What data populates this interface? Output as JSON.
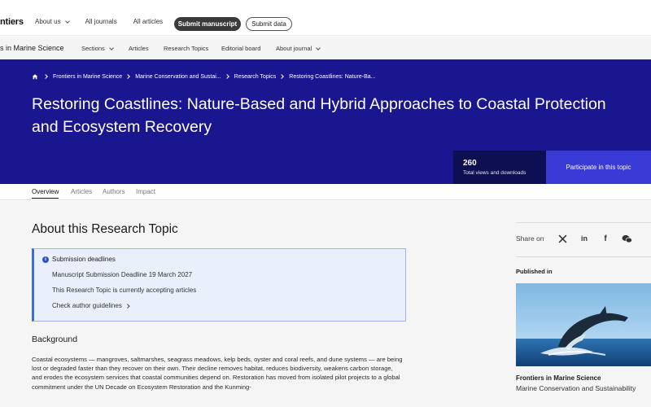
{
  "header": {
    "brand": "ntiers",
    "nav": [
      {
        "label": "About us",
        "has_dropdown": true
      },
      {
        "label": "All journals",
        "has_dropdown": false
      },
      {
        "label": "All articles",
        "has_dropdown": false
      }
    ],
    "submit_manuscript": "Submit manuscript",
    "submit_data": "Submit data"
  },
  "journal_nav": {
    "journal_name": "s in Marine Science",
    "items": [
      {
        "label": "Sections",
        "has_dropdown": true
      },
      {
        "label": "Articles",
        "has_dropdown": false
      },
      {
        "label": "Research Topics",
        "has_dropdown": false
      },
      {
        "label": "Editorial board",
        "has_dropdown": false
      },
      {
        "label": "About journal",
        "has_dropdown": true
      }
    ]
  },
  "breadcrumb": [
    "Frontiers in Marine Science",
    "Marine Conservation and Sustai...",
    "Research Topics",
    "Restoring Coastlines: Nature-Ba..."
  ],
  "hero": {
    "title_line1": "Restoring Coastlines: Nature-Based and Hybrid Approaches to Coastal Protection",
    "title_line2": "and Ecosystem Recovery",
    "views_count": "260",
    "views_label": "Total views and downloads",
    "participate": "Participate in this topic"
  },
  "tabs": [
    "Overview",
    "Articles",
    "Authors",
    "Impact"
  ],
  "about": {
    "title": "About this Research Topic",
    "deadlines": {
      "heading": "Submission deadlines",
      "manuscript_deadline": "Manuscript Submission Deadline 19 March 2027",
      "status": "This Research Topic is currently accepting articles",
      "guidelines_link": "Check author guidelines"
    },
    "background_title": "Background",
    "background_text": "Coastal ecosystems — mangroves, saltmarshes, seagrass meadows, kelp beds, oyster and coral reefs, and dune systems — are being lost or degraded faster than they recover on their own. Their decline removes habitat, reduces biodiversity, weakens carbon storage, and erodes the ecosystem services that coastal communities depend on. Restoration has moved from isolated pilot projects to a global commitment under the UN Decade on Ecosystem Restoration and the Kunming-"
  },
  "sidebar": {
    "share_label": "Share on",
    "share_icons": [
      "x-icon",
      "linkedin-icon",
      "facebook-icon",
      "wechat-icon"
    ],
    "published_in_label": "Published in",
    "journal": "Frontiers in Marine Science",
    "section": "Marine Conservation and Sustainability"
  },
  "colors": {
    "hero_bg": "#1a1690",
    "participate_bg": "#3a3ad6",
    "stats_bg": "#0e0e52",
    "info_border": "#3b6fd4"
  }
}
